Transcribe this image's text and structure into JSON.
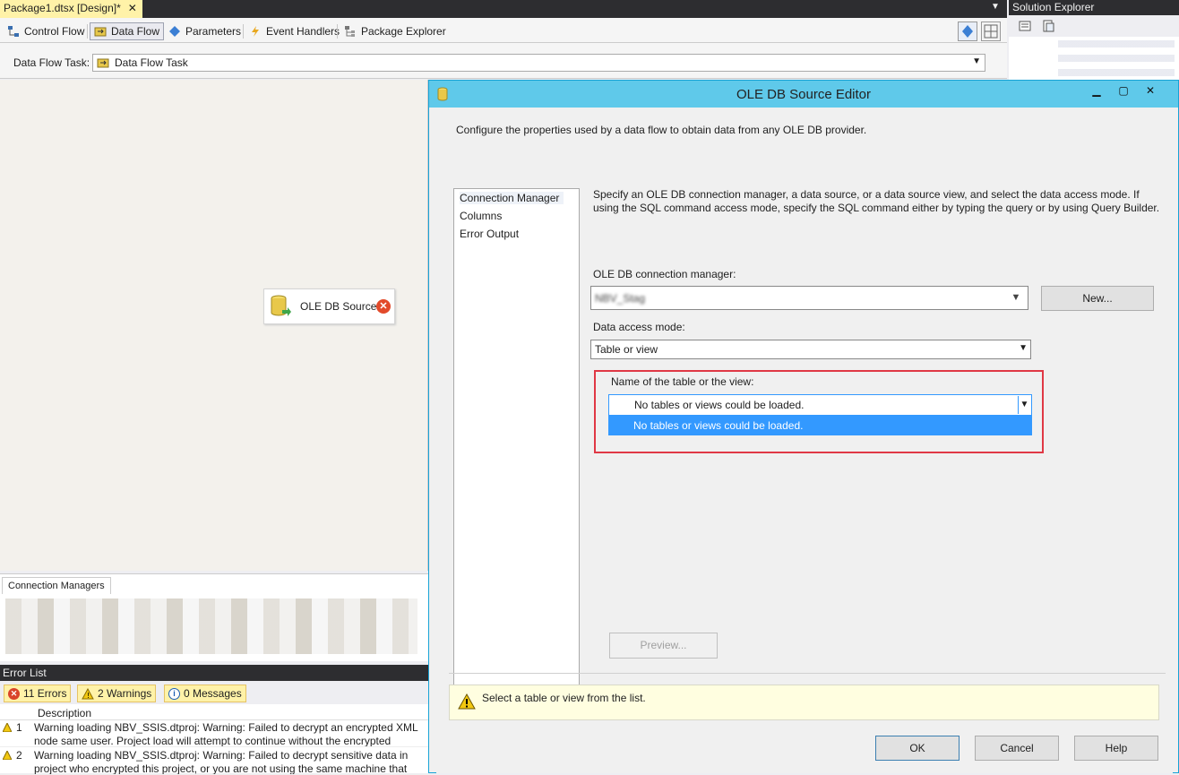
{
  "document_tab": {
    "title": "Package1.dtsx [Design]*",
    "close": "✕"
  },
  "designer_tabs": [
    {
      "label": "Control Flow"
    },
    {
      "label": "Data Flow"
    },
    {
      "label": "Parameters"
    },
    {
      "label": "Event Handlers"
    },
    {
      "label": "Package Explorer"
    }
  ],
  "task_row": {
    "label": "Data Flow Task:",
    "selected": "Data Flow Task"
  },
  "canvas": {
    "node_label": "OLE DB Source"
  },
  "connection_managers": {
    "tab_label": "Connection Managers"
  },
  "error_list": {
    "title": "Error List",
    "errors_label": "11 Errors",
    "warnings_label": "2 Warnings",
    "messages_label": "0 Messages",
    "column_description": "Description",
    "rows": [
      {
        "num": "1",
        "text": "Warning loading NBV_SSIS.dtproj: Warning: Failed to decrypt an encrypted XML node same user. Project load will attempt to continue without the encrypted information"
      },
      {
        "num": "2",
        "text": "Warning loading NBV_SSIS.dtproj: Warning: Failed to decrypt sensitive data in project who encrypted this project, or you are not using the same machine that was used to"
      }
    ]
  },
  "solution_explorer": {
    "title": "Solution Explorer"
  },
  "dialog": {
    "title": "OLE DB Source Editor",
    "description": "Configure the properties used by a data flow to obtain data from any OLE DB provider.",
    "pages": [
      "Connection Manager",
      "Columns",
      "Error Output"
    ],
    "page_description": "Specify an OLE DB connection manager, a data source, or a data source view, and select the data access mode. If using the SQL command access mode, specify the SQL command either by typing the query or by using Query Builder.",
    "conn_label": "OLE DB connection manager:",
    "conn_value": "NBV_Stag",
    "new_button": "New...",
    "mode_label": "Data access mode:",
    "mode_value": "Table or view",
    "table_label": "Name of the table or the view:",
    "table_value": "No tables or views could be loaded.",
    "table_option": "No tables or views could be loaded.",
    "preview_button": "Preview...",
    "status_text": "Select a table or view from the list.",
    "ok_button": "OK",
    "cancel_button": "Cancel",
    "help_button": "Help"
  },
  "colors": {
    "accent": "#5fc9ea",
    "highlight": "#e03845",
    "selection": "#3399ff",
    "tab_active": "#fff2a8"
  }
}
